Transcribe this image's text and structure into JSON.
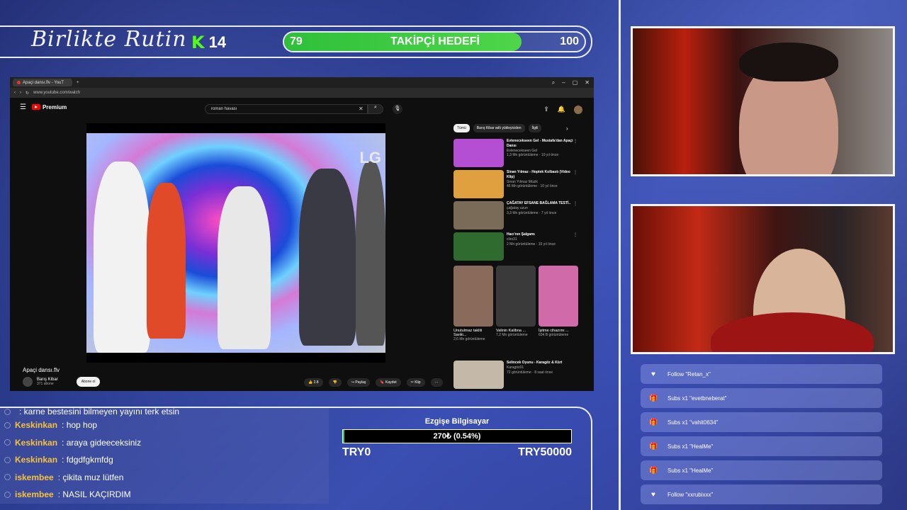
{
  "overlay": {
    "brand": "Birlikte Rutin",
    "kick": {
      "logo": "K",
      "followers": "14"
    },
    "goal": {
      "current": "79",
      "label": "TAKİPÇİ HEDEFİ",
      "target": "100",
      "progress": 0.79
    }
  },
  "browser": {
    "tab_title": "Apaçi dansı.flv - YouT",
    "url": "www.youtube.com/watch",
    "youtube": {
      "logo": "Premium",
      "search_value": "roman havası",
      "video_title": "Apaçi dansı.flv",
      "channel": "Barış Kibar",
      "subscribers": "371 abone",
      "subscribe_label": "Abone ol",
      "watermark": "LG",
      "actions": [
        "2.8",
        "",
        "Paylaş",
        "Kaydet",
        "Klip",
        "···"
      ],
      "chips": [
        "Tümü",
        "Barış Kibar adlı yükleyiciden",
        "İlgili"
      ],
      "recommendations": [
        {
          "title": "Evlenecekseen Gel - Mustafa'dan Apaçi Dansı",
          "channel": "Evlenecekseen Gel",
          "meta": "1,3 Mn görüntüleme · 10 yıl önce",
          "duration": "1:36",
          "color": "#b44fd4"
        },
        {
          "title": "Sinan Yılmaz - Hoptek Kolbastı (Video Klip)",
          "channel": "Sinan Yılmaz Müzik",
          "meta": "46 Mn görüntüleme · 10 yıl önce",
          "duration": "4:23",
          "color": "#e0a040"
        },
        {
          "title": "ÇAĞATAY EFSANE BAĞLAMA TESTİ..",
          "channel": "çağatay uzun",
          "meta": "3,3 Mn görüntüleme · 7 yıl önce",
          "duration": "1:01",
          "color": "#7a6a58"
        },
        {
          "title": "Hacı'nın Şalgamı",
          "channel": "cliro31",
          "meta": "2 Mn görüntüleme · 15 yıl önce",
          "duration": "0:31",
          "color": "#2f6a2f"
        }
      ],
      "shorts": [
        {
          "title": "Unutulmaz takliti Sanki...",
          "meta": "2,6 Mn görüntüleme",
          "color": "#8a6a5a"
        },
        {
          "title": "Valinin Kalibna ...",
          "meta": "7,2 Mn görüntüleme",
          "color": "#3a3a3a"
        },
        {
          "title": "İşitme cihazımı ...",
          "meta": "634 B görüntüleme",
          "color": "#d06aa8"
        }
      ],
      "last_rec": {
        "title": "Selincek Oyunu - Karagöz & Kürt",
        "channel": "Karagöz01",
        "meta": "72 görüntüleme · 8 saat önce",
        "badge": "Yeni",
        "duration": "2:58"
      }
    }
  },
  "events": [
    {
      "icon": "heart-icon",
      "glyph": "♥",
      "text": "Follow \"Retan_x\""
    },
    {
      "icon": "gift-icon",
      "glyph": "🎁",
      "text": "Subs x1 \"evetbneberat\""
    },
    {
      "icon": "gift-icon",
      "glyph": "🎁",
      "text": "Subs x1 \"vahit0634\""
    },
    {
      "icon": "gift-icon",
      "glyph": "🎁",
      "text": "Subs x1 \"HealMe\""
    },
    {
      "icon": "gift-icon",
      "glyph": "🎁",
      "text": "Subs x1 \"HealMe\""
    },
    {
      "icon": "heart-icon",
      "glyph": "♥",
      "text": "Follow \"xxrubixxx\""
    }
  ],
  "chat": [
    {
      "user": "",
      "msg": ": karne bestesini bilmeyen yayını terk etsin",
      "color": "red"
    },
    {
      "user": "Keskinkan",
      "msg": ": hop hop"
    },
    {
      "user": "Keskinkan",
      "msg": ": araya gideeceksiniz"
    },
    {
      "user": "Keskinkan",
      "msg": ": fdgdfgkmfdg"
    },
    {
      "user": "iskembee",
      "msg": ": çikita muz lütfen"
    },
    {
      "user": "iskembee",
      "msg": ": NASIL KAÇIRDIM"
    }
  ],
  "donation": {
    "title": "Ezgişe Bilgisayar",
    "amount": "270₺ (0.54%)",
    "progress": 0.0054,
    "min": "TRY0",
    "max": "TRY50000"
  }
}
